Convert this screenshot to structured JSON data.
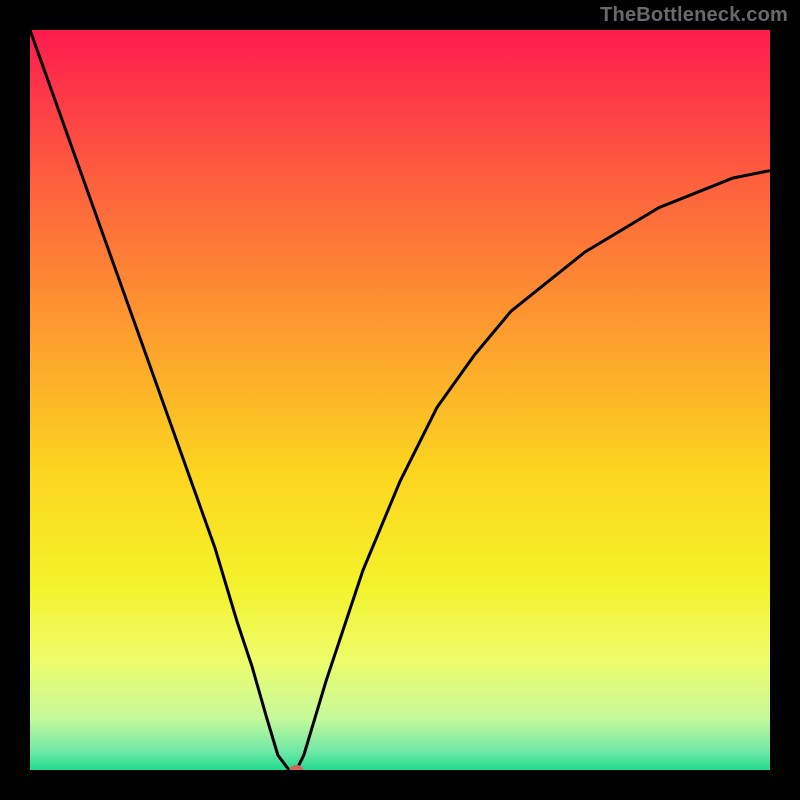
{
  "watermark": "TheBottleneck.com",
  "chart_data": {
    "type": "line",
    "title": "",
    "xlabel": "",
    "ylabel": "",
    "xlim": [
      0,
      100
    ],
    "ylim": [
      0,
      100
    ],
    "grid": false,
    "legend": false,
    "series": [
      {
        "name": "bottleneck-curve",
        "x": [
          0,
          5,
          10,
          15,
          20,
          25,
          28,
          30,
          32,
          33.5,
          35,
          36,
          37,
          40,
          45,
          50,
          55,
          60,
          65,
          70,
          75,
          80,
          85,
          90,
          95,
          100
        ],
        "y": [
          100,
          86,
          72,
          58,
          44,
          30,
          20,
          14,
          7,
          2,
          0,
          0,
          2,
          12,
          27,
          39,
          49,
          56,
          62,
          66,
          70,
          73,
          76,
          78,
          80,
          81
        ],
        "color": "#000000"
      }
    ],
    "marker": {
      "x": 36,
      "y": 0,
      "color": "#cf6a5a"
    },
    "background_gradient": {
      "stops": [
        {
          "offset": 0.0,
          "color": "#fe1b4e"
        },
        {
          "offset": 0.2,
          "color": "#fd5e3e"
        },
        {
          "offset": 0.4,
          "color": "#fd9a2f"
        },
        {
          "offset": 0.6,
          "color": "#fcd61f"
        },
        {
          "offset": 0.75,
          "color": "#f4f22a"
        },
        {
          "offset": 0.85,
          "color": "#eefc6a"
        },
        {
          "offset": 0.93,
          "color": "#c6f99a"
        },
        {
          "offset": 0.975,
          "color": "#6fe8a6"
        },
        {
          "offset": 1.0,
          "color": "#22da8f"
        }
      ]
    }
  }
}
